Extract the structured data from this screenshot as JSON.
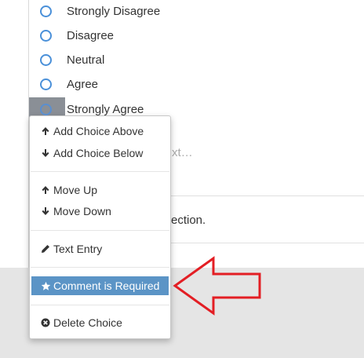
{
  "choices": [
    {
      "label": "Strongly Disagree"
    },
    {
      "label": "Disagree"
    },
    {
      "label": "Neutral"
    },
    {
      "label": "Agree"
    },
    {
      "label": "Strongly Agree"
    }
  ],
  "background_fragments": {
    "add_choice_tail": "xt…",
    "section_tail": "ection."
  },
  "context_menu": {
    "items": [
      {
        "label": "Add Choice Above",
        "icon": "arrow-up-icon"
      },
      {
        "label": "Add Choice Below",
        "icon": "arrow-down-icon"
      },
      {
        "label": "Move Up",
        "icon": "arrow-up-icon"
      },
      {
        "label": "Move Down",
        "icon": "arrow-down-icon"
      },
      {
        "label": "Text Entry",
        "icon": "pencil-icon"
      },
      {
        "label": "Comment is Required",
        "icon": "star-icon",
        "highlighted": true
      },
      {
        "label": "Delete Choice",
        "icon": "times-circle-icon"
      }
    ]
  },
  "colors": {
    "radio_border": "#4a90d9",
    "menu_highlight": "#5b94c6",
    "selected_row": "#8a8f96",
    "callout_arrow": "#e31e24",
    "page_background": "#e5e5e5"
  }
}
